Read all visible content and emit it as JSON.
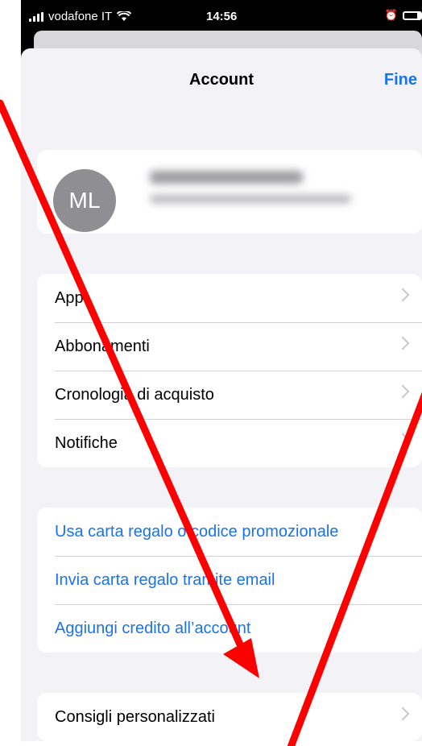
{
  "status_bar": {
    "carrier": "vodafone IT",
    "time": "14:56"
  },
  "nav": {
    "title": "Account",
    "done": "Fine"
  },
  "profile": {
    "initials": "ML"
  },
  "menu_main": [
    "App",
    "Abbonamenti",
    "Cronologia di acquisto",
    "Notifiche"
  ],
  "menu_gift": [
    "Usa carta regalo o codice promozionale",
    "Invia carta regalo tramite email",
    "Aggiungi credito all’account"
  ],
  "menu_extra": [
    "Consigli personalizzati"
  ],
  "colors": {
    "accent": "#1a73e8",
    "annotation": "#ff0000"
  }
}
